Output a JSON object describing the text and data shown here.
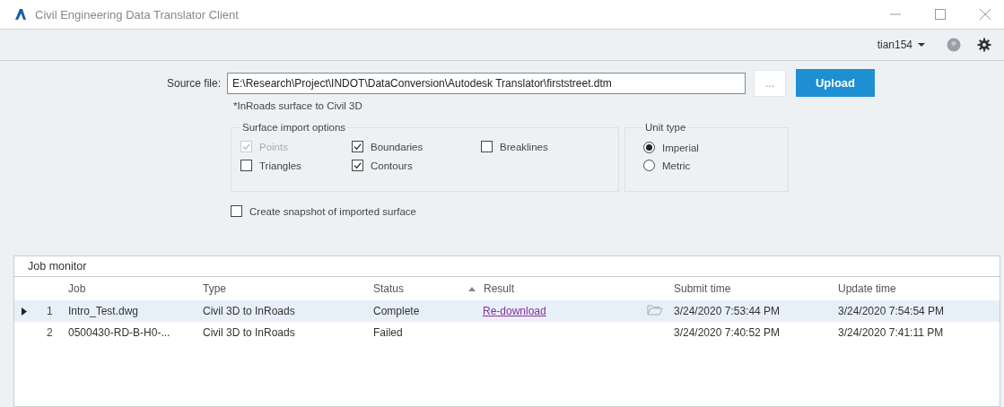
{
  "window": {
    "title": "Civil Engineering Data Translator Client"
  },
  "toolbar": {
    "user": "tian154"
  },
  "source": {
    "label": "Source file:",
    "value": "E:\\Research\\Project\\INDOT\\DataConversion\\Autodesk Translator\\firststreet.dtm",
    "browse": "...",
    "upload": "Upload",
    "note": "*InRoads surface to Civil 3D"
  },
  "surface_options": {
    "title": "Surface import options",
    "items": [
      {
        "label": "Points",
        "checked": true,
        "disabled": true
      },
      {
        "label": "Boundaries",
        "checked": true,
        "disabled": false
      },
      {
        "label": "Breaklines",
        "checked": false,
        "disabled": false
      },
      {
        "label": "Triangles",
        "checked": false,
        "disabled": false
      },
      {
        "label": "Contours",
        "checked": true,
        "disabled": false
      }
    ]
  },
  "unit_type": {
    "title": "Unit type",
    "options": [
      {
        "label": "Imperial",
        "selected": true
      },
      {
        "label": "Metric",
        "selected": false
      }
    ]
  },
  "snapshot": {
    "label": "Create snapshot of imported surface",
    "checked": false
  },
  "job_monitor": {
    "title": "Job monitor",
    "columns": [
      "Job",
      "Type",
      "Status",
      "Result",
      "Submit time",
      "Update time"
    ],
    "rows": [
      {
        "selected": true,
        "number": "1",
        "job": "Intro_Test.dwg",
        "type": "Civil 3D to InRoads",
        "status": "Complete",
        "result": "Re-download",
        "submit": "3/24/2020 7:53:44 PM",
        "update": "3/24/2020 7:54:54 PM"
      },
      {
        "selected": false,
        "number": "2",
        "job": "0500430-RD-B-H0-...",
        "type": "Civil 3D to InRoads",
        "status": "Failed",
        "submit": "3/24/2020 7:40:52 PM",
        "update": "3/24/2020 7:41:11 PM"
      }
    ]
  }
}
